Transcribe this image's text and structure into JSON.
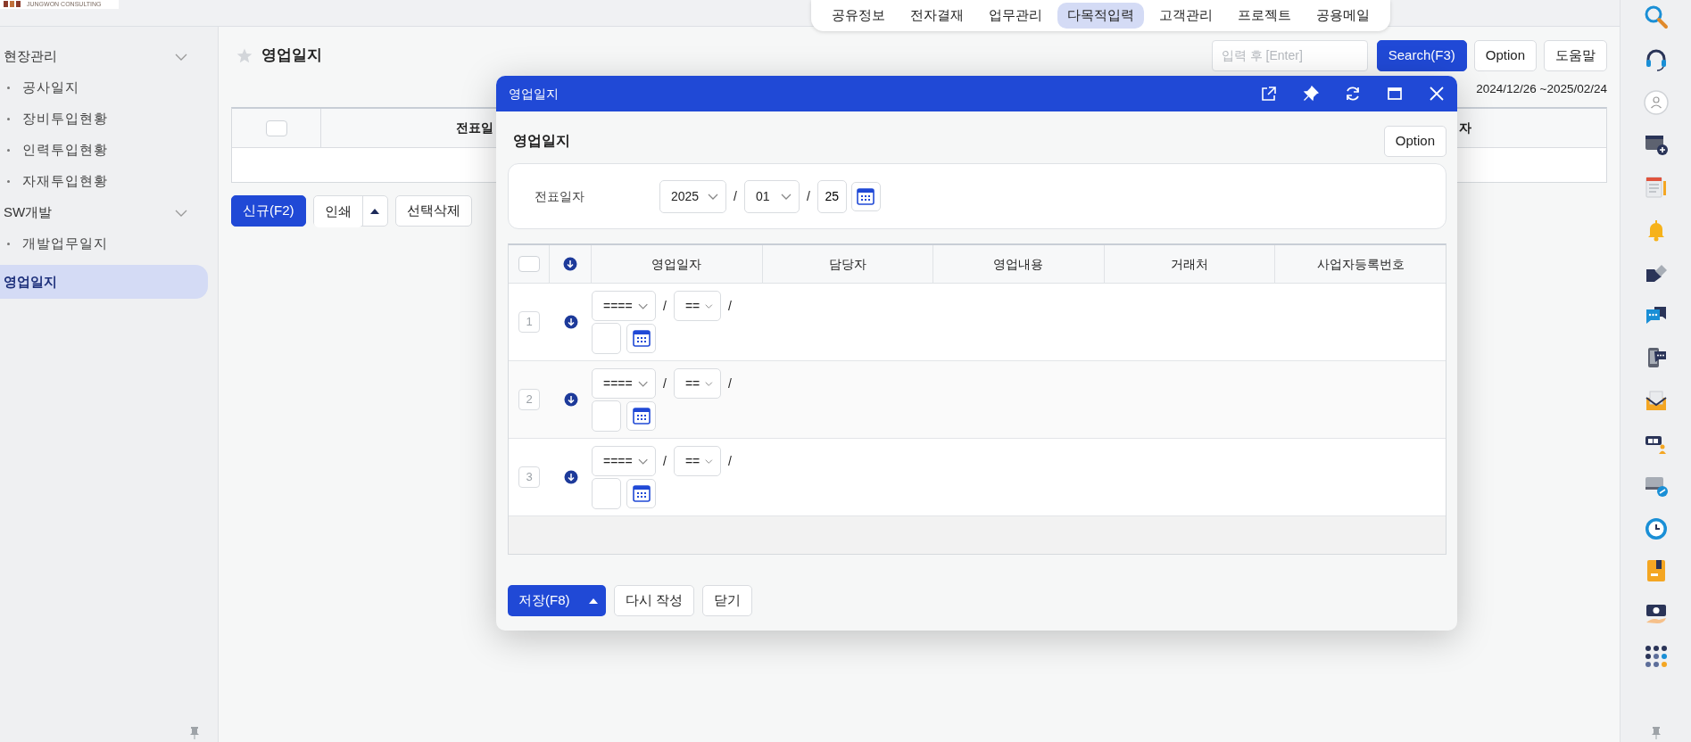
{
  "logo": {
    "subtitle": "JUNGWON CONSULTING"
  },
  "top_nav": [
    {
      "label": "공유정보",
      "selected": false
    },
    {
      "label": "전자결재",
      "selected": false
    },
    {
      "label": "업무관리",
      "selected": false
    },
    {
      "label": "다목적입력",
      "selected": true
    },
    {
      "label": "고객관리",
      "selected": false
    },
    {
      "label": "프로젝트",
      "selected": false
    },
    {
      "label": "공용메일",
      "selected": false
    }
  ],
  "sidebar": {
    "items": [
      {
        "kind": "group",
        "label": "현장관리",
        "expanded": true,
        "children": [
          {
            "label": "공사일지",
            "selected": false
          },
          {
            "label": "장비투입현황",
            "selected": false
          },
          {
            "label": "인력투입현황",
            "selected": false
          },
          {
            "label": "자재투입현황",
            "selected": false
          }
        ]
      },
      {
        "kind": "group",
        "label": "SW개발",
        "expanded": true,
        "children": [
          {
            "label": "개발업무일지",
            "selected": false
          }
        ]
      },
      {
        "kind": "link",
        "label": "영업일지",
        "selected": true
      }
    ]
  },
  "page": {
    "title": "영업일지",
    "favorite": false,
    "search": {
      "placeholder": "입력 후 [Enter]"
    },
    "buttons": [
      {
        "label": "Search(F3)",
        "kind": "primary"
      },
      {
        "label": "Option",
        "kind": "default"
      },
      {
        "label": "도움말",
        "kind": "default"
      }
    ],
    "date_range": "2024/12/26 ~2025/02/24",
    "table": {
      "select_all": {
        "checked": false
      },
      "columns": [
        "전표일",
        "자"
      ]
    },
    "actions": [
      {
        "label": "신규(F2)",
        "kind": "primary"
      },
      {
        "label": "인쇄",
        "kind": "split"
      },
      {
        "label": "선택삭제",
        "kind": "default"
      }
    ]
  },
  "modal": {
    "title": "영업일지",
    "heading": "영업일지",
    "option": "Option",
    "filter": {
      "label": "전표일자",
      "year": "2025",
      "month": "01",
      "day": "25",
      "separators": [
        "/",
        "/"
      ]
    },
    "table": {
      "select_all": {
        "checked": false
      },
      "columns": [
        "영업일자",
        "담당자",
        "영업내용",
        "거래처",
        "사업자등록번호"
      ],
      "rows": [
        {
          "number": "1",
          "year": "====",
          "month": "==",
          "separators": [
            "/",
            "/"
          ]
        },
        {
          "number": "2",
          "year": "====",
          "month": "==",
          "separators": [
            "/",
            "/"
          ]
        },
        {
          "number": "3",
          "year": "====",
          "month": "==",
          "separators": [
            "/",
            "/"
          ]
        }
      ]
    },
    "buttons": [
      {
        "label": "저장(F8)",
        "kind": "split-primary"
      },
      {
        "label": "다시 작성",
        "kind": "default"
      },
      {
        "label": "닫기",
        "kind": "default"
      }
    ]
  }
}
